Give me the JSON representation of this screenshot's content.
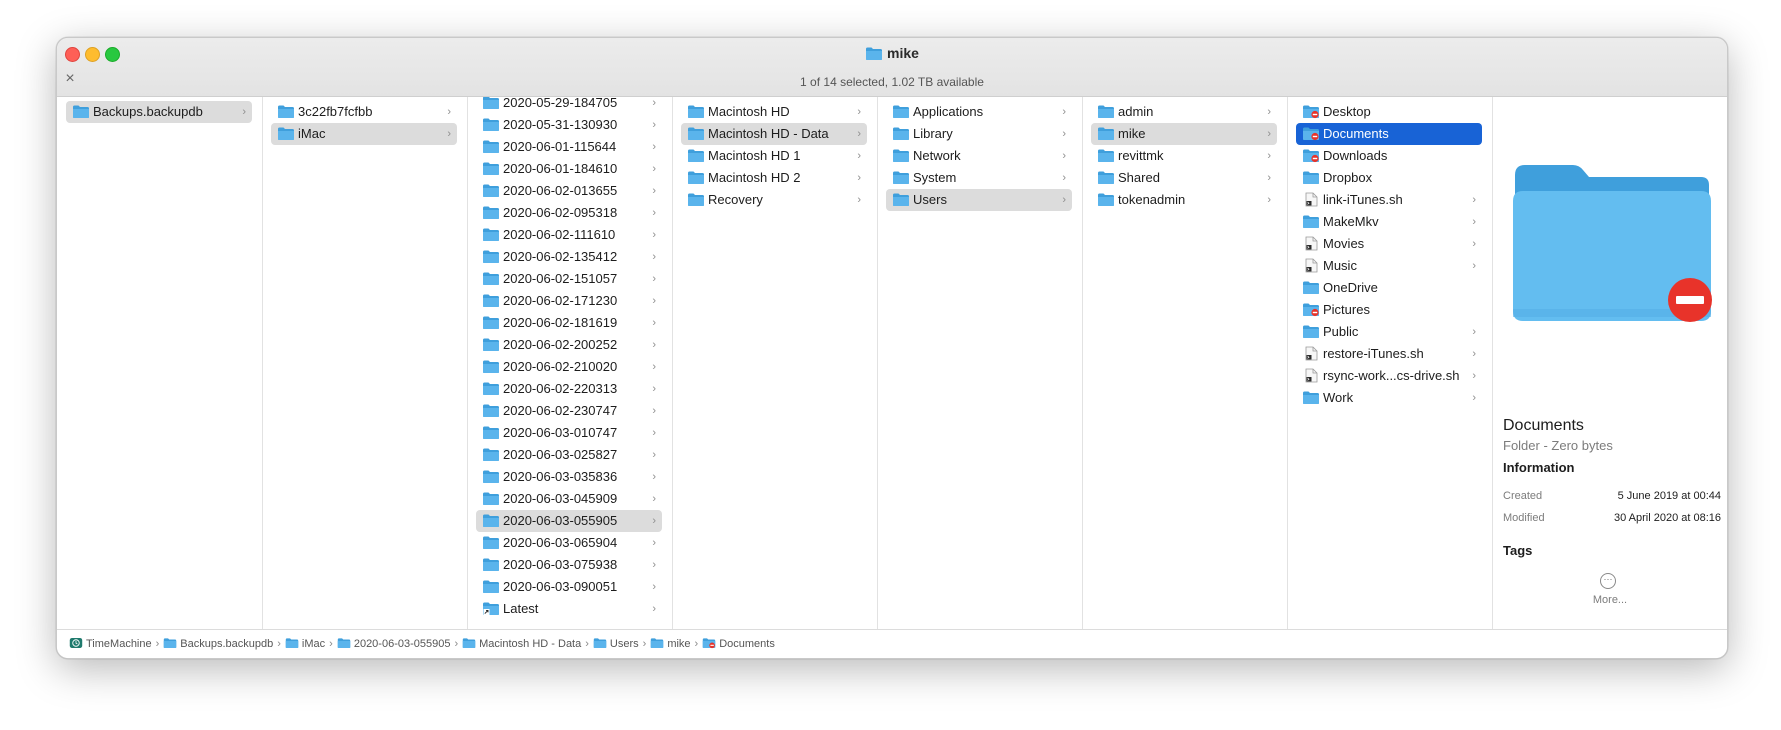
{
  "window": {
    "title": "mike",
    "status": "1 of 14 selected, 1.02 TB available",
    "close_symbol": "×"
  },
  "columns": [
    {
      "items": [
        {
          "label": "Backups.backupdb",
          "icon": "folder-icon",
          "chevron": true,
          "state": "grey"
        }
      ]
    },
    {
      "items": [
        {
          "label": "3c22fb7fcfbb",
          "icon": "folder-icon",
          "chevron": true,
          "state": ""
        },
        {
          "label": "iMac",
          "icon": "folder-icon",
          "chevron": true,
          "state": "grey"
        }
      ]
    },
    {
      "items": [
        {
          "label": "2020-05-29-184705",
          "icon": "folder-icon",
          "chevron": true,
          "state": ""
        },
        {
          "label": "2020-05-31-130930",
          "icon": "folder-icon",
          "chevron": true,
          "state": ""
        },
        {
          "label": "2020-06-01-115644",
          "icon": "folder-icon",
          "chevron": true,
          "state": ""
        },
        {
          "label": "2020-06-01-184610",
          "icon": "folder-icon",
          "chevron": true,
          "state": ""
        },
        {
          "label": "2020-06-02-013655",
          "icon": "folder-icon",
          "chevron": true,
          "state": ""
        },
        {
          "label": "2020-06-02-095318",
          "icon": "folder-icon",
          "chevron": true,
          "state": ""
        },
        {
          "label": "2020-06-02-111610",
          "icon": "folder-icon",
          "chevron": true,
          "state": ""
        },
        {
          "label": "2020-06-02-135412",
          "icon": "folder-icon",
          "chevron": true,
          "state": ""
        },
        {
          "label": "2020-06-02-151057",
          "icon": "folder-icon",
          "chevron": true,
          "state": ""
        },
        {
          "label": "2020-06-02-171230",
          "icon": "folder-icon",
          "chevron": true,
          "state": ""
        },
        {
          "label": "2020-06-02-181619",
          "icon": "folder-icon",
          "chevron": true,
          "state": ""
        },
        {
          "label": "2020-06-02-200252",
          "icon": "folder-icon",
          "chevron": true,
          "state": ""
        },
        {
          "label": "2020-06-02-210020",
          "icon": "folder-icon",
          "chevron": true,
          "state": ""
        },
        {
          "label": "2020-06-02-220313",
          "icon": "folder-icon",
          "chevron": true,
          "state": ""
        },
        {
          "label": "2020-06-02-230747",
          "icon": "folder-icon",
          "chevron": true,
          "state": ""
        },
        {
          "label": "2020-06-03-010747",
          "icon": "folder-icon",
          "chevron": true,
          "state": ""
        },
        {
          "label": "2020-06-03-025827",
          "icon": "folder-icon",
          "chevron": true,
          "state": ""
        },
        {
          "label": "2020-06-03-035836",
          "icon": "folder-icon",
          "chevron": true,
          "state": ""
        },
        {
          "label": "2020-06-03-045909",
          "icon": "folder-icon",
          "chevron": true,
          "state": ""
        },
        {
          "label": "2020-06-03-055905",
          "icon": "folder-icon",
          "chevron": true,
          "state": "grey"
        },
        {
          "label": "2020-06-03-065904",
          "icon": "folder-icon",
          "chevron": true,
          "state": ""
        },
        {
          "label": "2020-06-03-075938",
          "icon": "folder-icon",
          "chevron": true,
          "state": ""
        },
        {
          "label": "2020-06-03-090051",
          "icon": "folder-icon",
          "chevron": true,
          "state": ""
        },
        {
          "label": "Latest",
          "icon": "alias-icon",
          "chevron": true,
          "state": ""
        }
      ]
    },
    {
      "items": [
        {
          "label": "Macintosh HD",
          "icon": "folder-icon",
          "chevron": true,
          "state": ""
        },
        {
          "label": "Macintosh HD - Data",
          "icon": "folder-icon",
          "chevron": true,
          "state": "grey"
        },
        {
          "label": "Macintosh HD 1",
          "icon": "folder-icon",
          "chevron": true,
          "state": ""
        },
        {
          "label": "Macintosh HD 2",
          "icon": "folder-icon",
          "chevron": true,
          "state": ""
        },
        {
          "label": "Recovery",
          "icon": "folder-icon",
          "chevron": true,
          "state": ""
        }
      ]
    },
    {
      "items": [
        {
          "label": "Applications",
          "icon": "folder-icon",
          "chevron": true,
          "state": ""
        },
        {
          "label": "Library",
          "icon": "folder-icon",
          "chevron": true,
          "state": ""
        },
        {
          "label": "Network",
          "icon": "folder-icon",
          "chevron": true,
          "state": ""
        },
        {
          "label": "System",
          "icon": "folder-icon",
          "chevron": true,
          "state": ""
        },
        {
          "label": "Users",
          "icon": "folder-icon",
          "chevron": true,
          "state": "grey"
        }
      ]
    },
    {
      "items": [
        {
          "label": "admin",
          "icon": "folder-icon",
          "chevron": true,
          "state": ""
        },
        {
          "label": "mike",
          "icon": "folder-icon",
          "chevron": true,
          "state": "grey"
        },
        {
          "label": "revittmk",
          "icon": "folder-icon",
          "chevron": true,
          "state": ""
        },
        {
          "label": "Shared",
          "icon": "folder-icon",
          "chevron": true,
          "state": ""
        },
        {
          "label": "tokenadmin",
          "icon": "folder-icon",
          "chevron": true,
          "state": ""
        }
      ]
    },
    {
      "items": [
        {
          "label": "Desktop",
          "icon": "restricted-folder-icon",
          "chevron": false,
          "state": ""
        },
        {
          "label": "Documents",
          "icon": "restricted-folder-icon",
          "chevron": false,
          "state": "blue"
        },
        {
          "label": "Downloads",
          "icon": "restricted-folder-icon",
          "chevron": false,
          "state": ""
        },
        {
          "label": "Dropbox",
          "icon": "folder-icon",
          "chevron": false,
          "state": ""
        },
        {
          "label": "link-iTunes.sh",
          "icon": "script-file-icon",
          "chevron": true,
          "state": ""
        },
        {
          "label": "MakeMkv",
          "icon": "folder-icon",
          "chevron": true,
          "state": ""
        },
        {
          "label": "Movies",
          "icon": "script-file-icon",
          "chevron": true,
          "state": ""
        },
        {
          "label": "Music",
          "icon": "script-file-icon",
          "chevron": true,
          "state": ""
        },
        {
          "label": "OneDrive",
          "icon": "folder-icon",
          "chevron": false,
          "state": ""
        },
        {
          "label": "Pictures",
          "icon": "restricted-folder-icon",
          "chevron": false,
          "state": ""
        },
        {
          "label": "Public",
          "icon": "folder-icon",
          "chevron": true,
          "state": ""
        },
        {
          "label": "restore-iTunes.sh",
          "icon": "script-file-icon",
          "chevron": true,
          "state": ""
        },
        {
          "label": "rsync-work...cs-drive.sh",
          "icon": "script-file-icon",
          "chevron": true,
          "state": ""
        },
        {
          "label": "Work",
          "icon": "folder-icon",
          "chevron": true,
          "state": ""
        }
      ]
    }
  ],
  "preview": {
    "name": "Documents",
    "kind": "Folder - Zero bytes",
    "info_heading": "Information",
    "created_label": "Created",
    "created_value": "5 June 2019 at 00:44",
    "modified_label": "Modified",
    "modified_value": "30 April 2020 at 08:16",
    "tags_heading": "Tags",
    "more_label": "More...",
    "more_icon_glyph": "···"
  },
  "pathbar": [
    {
      "label": "TimeMachine",
      "icon": "time-machine-icon"
    },
    {
      "label": "Backups.backupdb",
      "icon": "folder-icon"
    },
    {
      "label": "iMac",
      "icon": "folder-icon"
    },
    {
      "label": "2020-06-03-055905",
      "icon": "folder-icon"
    },
    {
      "label": "Macintosh HD - Data",
      "icon": "folder-icon"
    },
    {
      "label": "Users",
      "icon": "folder-icon"
    },
    {
      "label": "mike",
      "icon": "folder-icon"
    },
    {
      "label": "Documents",
      "icon": "restricted-folder-icon"
    }
  ],
  "colors": {
    "folder": "#5ab4ec",
    "folder_dark": "#3f9fdc",
    "selection_blue": "#1863d6",
    "selection_grey": "#dcdcdc",
    "restricted": "#e8332a"
  }
}
